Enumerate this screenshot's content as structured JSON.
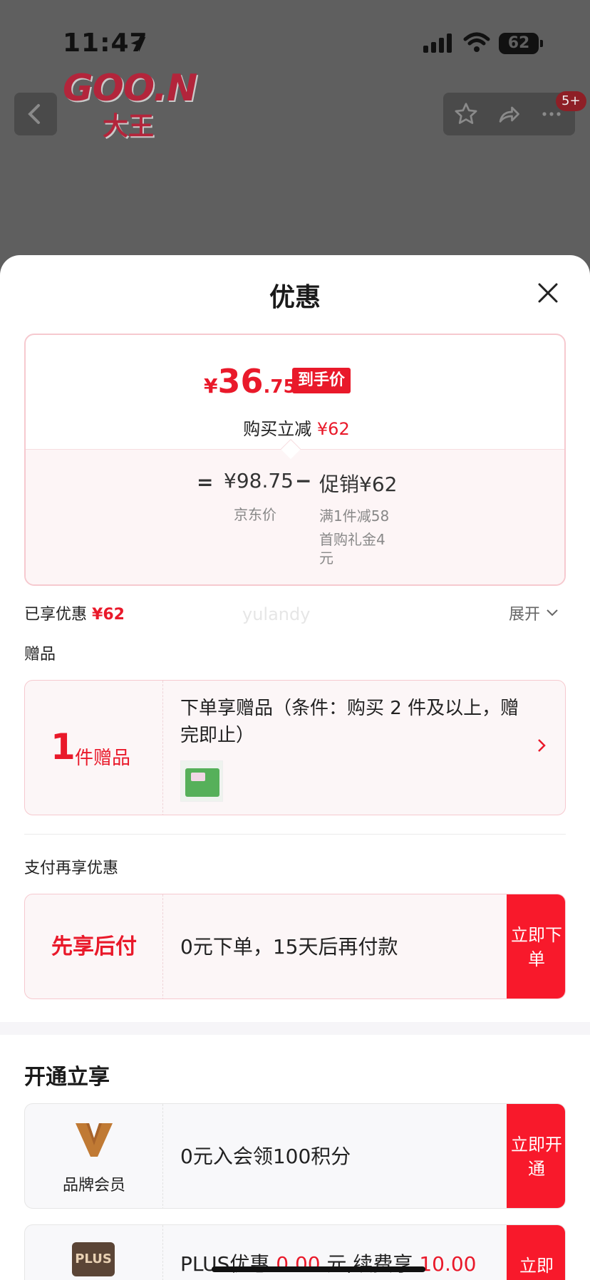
{
  "status_bar": {
    "time": "11:47",
    "battery": "62"
  },
  "header": {
    "logo_text": "GOO.N",
    "logo_sub": "大王",
    "notification_badge": "5+"
  },
  "sheet": {
    "title": "优惠",
    "price_card": {
      "currency": "¥",
      "final_int": "36",
      "final_dec": ".75",
      "tag": "到手价",
      "save_label": "购买立减",
      "save_value": "¥62",
      "eq": "=",
      "jd_price": "¥98.75",
      "jd_label": "京东价",
      "minus": "−",
      "promo": "促销¥62",
      "promo_detail_1": "满1件减58",
      "promo_detail_2": "首购礼金4元"
    },
    "enjoyed": {
      "label": "已享优惠",
      "value": "¥62",
      "expand": "展开"
    },
    "watermark": "yulandy",
    "gift": {
      "section_label": "赠品",
      "count": "1",
      "count_unit": "件赠品",
      "description": "下单享赠品（条件：购买 2 件及以上，赠完即止）"
    },
    "pay": {
      "section_label": "支付再享优惠",
      "offer_label": "先享后付",
      "offer_text": "0元下单，15天后再付款",
      "button": "立即下单"
    },
    "open": {
      "title": "开通立享",
      "brand_member": {
        "name": "品牌会员",
        "text": "0元入会领100积分",
        "button": "立即开通"
      },
      "plus": {
        "logo": "PLUS",
        "text_a": "PLUS优惠",
        "amount_a": "0.00",
        "text_b": "元,续费享",
        "amount_b": "10.00",
        "button": "立即"
      }
    }
  },
  "colors": {
    "accent": "#e9192a",
    "button": "#f8192b",
    "card_border": "#f6c9cf",
    "card_bg": "#fcf6f7"
  }
}
